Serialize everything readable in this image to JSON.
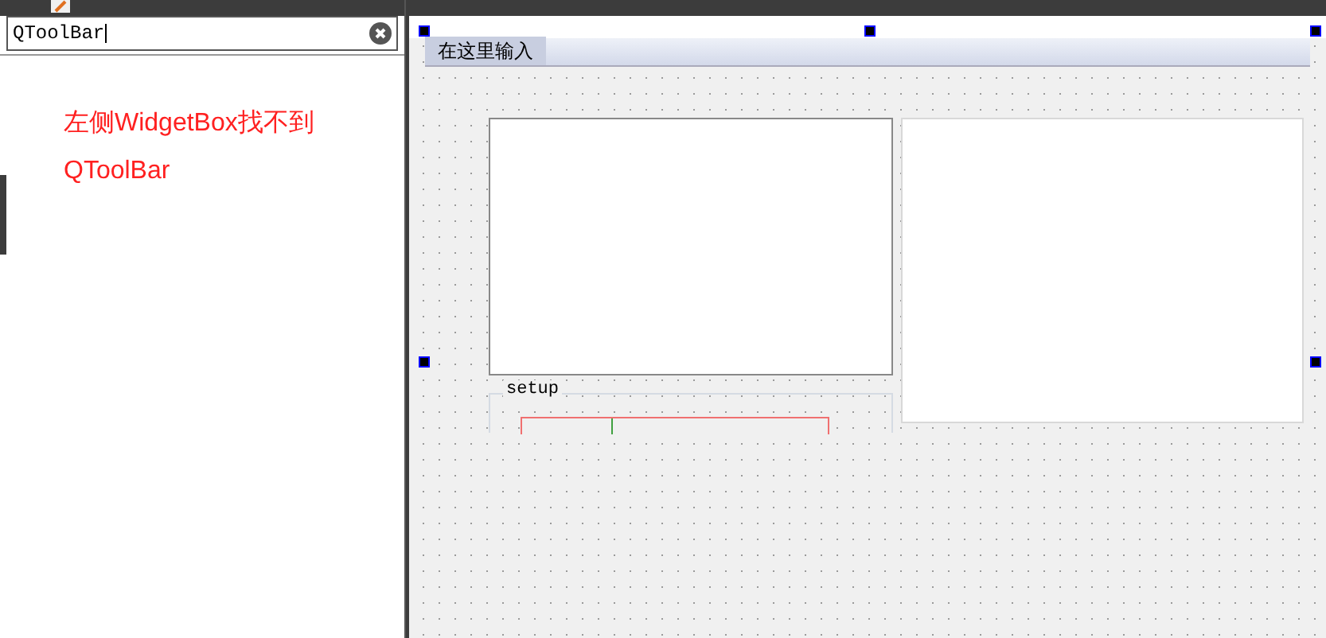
{
  "search": {
    "value": "QToolBar"
  },
  "annotation": "左侧WidgetBox找不到QToolBar",
  "form": {
    "menu_items": [
      {
        "label": "在这里输入",
        "selected": true
      }
    ],
    "group_title": "setup"
  }
}
